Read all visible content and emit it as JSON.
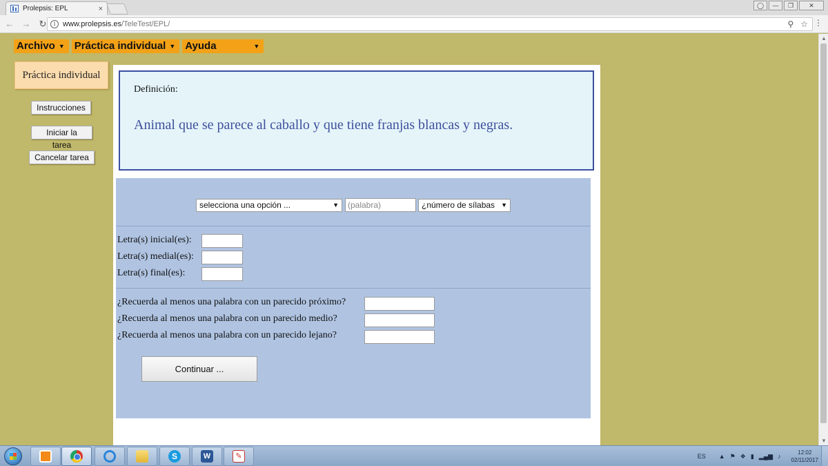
{
  "browser": {
    "tab_title": "Prolepsis: EPL",
    "tab_close": "×",
    "url_host": "www.prolepsis.es",
    "url_path": "/TeleTest/EPL/",
    "window_buttons": [
      "minimize-icon",
      "restore-icon",
      "close-icon"
    ]
  },
  "menu": {
    "items": [
      {
        "label": "Archivo"
      },
      {
        "label": "Práctica individual"
      },
      {
        "label": "Ayuda"
      }
    ],
    "caret": "▼"
  },
  "sidebar": {
    "title": "Práctica individual",
    "buttons": [
      {
        "label": "Instrucciones"
      },
      {
        "label": "Iniciar la tarea"
      },
      {
        "label": "Cancelar tarea"
      }
    ]
  },
  "definition": {
    "label": "Definición:",
    "text": "Animal que se parece al caballo y que tiene franjas blancas y negras."
  },
  "form": {
    "option_select": "selecciona una opción ...",
    "word_placeholder": "(palabra)",
    "syllables_select": "¿número de sílabas",
    "letters": [
      {
        "label": "Letra(s) inicial(es):"
      },
      {
        "label": "Letra(s) medial(es):"
      },
      {
        "label": "Letra(s) final(es):"
      }
    ],
    "recall": [
      {
        "label": "¿Recuerda al menos una palabra con un parecido próximo?"
      },
      {
        "label": "¿Recuerda al menos una palabra con un parecido medio?"
      },
      {
        "label": "¿Recuerda al menos una palabra con un parecido lejano?"
      }
    ],
    "continue_label": "Continuar ..."
  },
  "taskbar": {
    "apps": [
      "media-player-icon",
      "chrome-icon",
      "internet-explorer-icon",
      "folder-icon",
      "skype-icon",
      "word-icon",
      "pdf-icon"
    ],
    "skype_glyph": "S",
    "word_glyph": "W",
    "pdf_glyph": "✎",
    "language": "ES",
    "time": "12:02",
    "date": "02/11/2017"
  }
}
